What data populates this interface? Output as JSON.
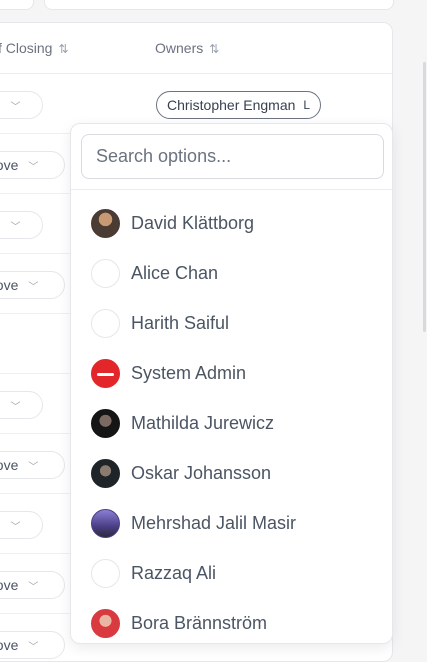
{
  "table": {
    "columns": [
      {
        "label": "f Closing",
        "sort_icon": "sort-icon"
      },
      {
        "label": "Owners",
        "sort_icon": "sort-icon"
      }
    ],
    "rows": [
      {
        "value": "%",
        "kind": "short"
      },
      {
        "value": "bove",
        "kind": "long"
      },
      {
        "value": "%",
        "kind": "short"
      },
      {
        "value": "bove",
        "kind": "long"
      },
      {
        "value": "",
        "kind": "none"
      },
      {
        "value": "%",
        "kind": "short"
      },
      {
        "value": "bove",
        "kind": "long"
      },
      {
        "value": "%",
        "kind": "short"
      },
      {
        "value": "bove",
        "kind": "long"
      },
      {
        "value": "bove",
        "kind": "long"
      }
    ],
    "selected_owner": "Christopher Engman"
  },
  "dropdown": {
    "search_placeholder": "Search options...",
    "options": [
      {
        "name": "David Klättborg",
        "avatar": "photo1"
      },
      {
        "name": "Alice Chan",
        "avatar": "blank"
      },
      {
        "name": "Harith Saiful",
        "avatar": "blank"
      },
      {
        "name": "System Admin",
        "avatar": "red"
      },
      {
        "name": "Mathilda Jurewicz",
        "avatar": "photo2"
      },
      {
        "name": "Oskar Johansson",
        "avatar": "photo3"
      },
      {
        "name": "Mehrshad Jalil Masir",
        "avatar": "photo4"
      },
      {
        "name": "Razzaq Ali",
        "avatar": "blank"
      },
      {
        "name": "Bora Brännström",
        "avatar": "photo5"
      }
    ]
  }
}
